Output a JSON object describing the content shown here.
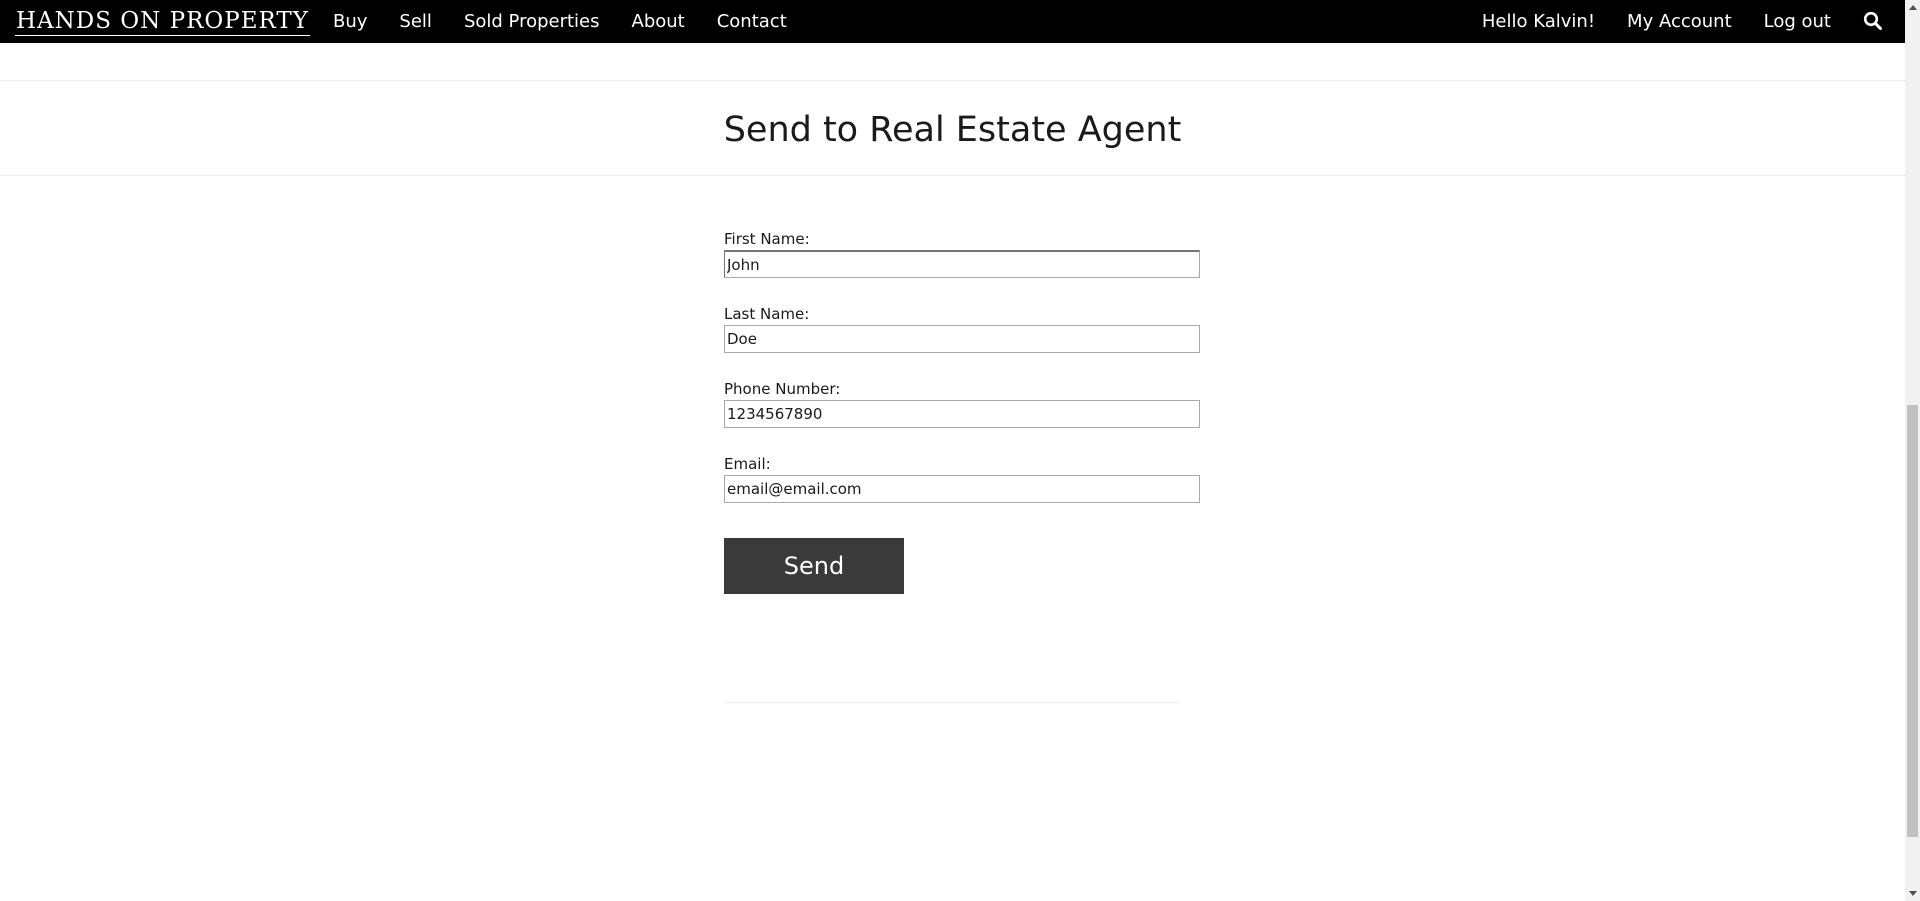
{
  "nav": {
    "logo": "HANDS ON PROPERTY",
    "links": [
      "Buy",
      "Sell",
      "Sold Properties",
      "About",
      "Contact"
    ],
    "greeting": "Hello Kalvin!",
    "my_account": "My Account",
    "logout": "Log out",
    "search_icon": "search-icon"
  },
  "header": {
    "title": "Send to Real Estate Agent"
  },
  "form": {
    "first_name": {
      "label": "First Name:",
      "value": "John"
    },
    "last_name": {
      "label": "Last Name:",
      "value": "Doe"
    },
    "phone": {
      "label": "Phone Number:",
      "value": "1234567890"
    },
    "email": {
      "label": "Email:",
      "value": "email@email.com"
    },
    "submit_label": "Send"
  },
  "colors": {
    "nav_bg": "#000000",
    "button_bg": "#3a3a3a",
    "text": "#1a1a1a"
  }
}
